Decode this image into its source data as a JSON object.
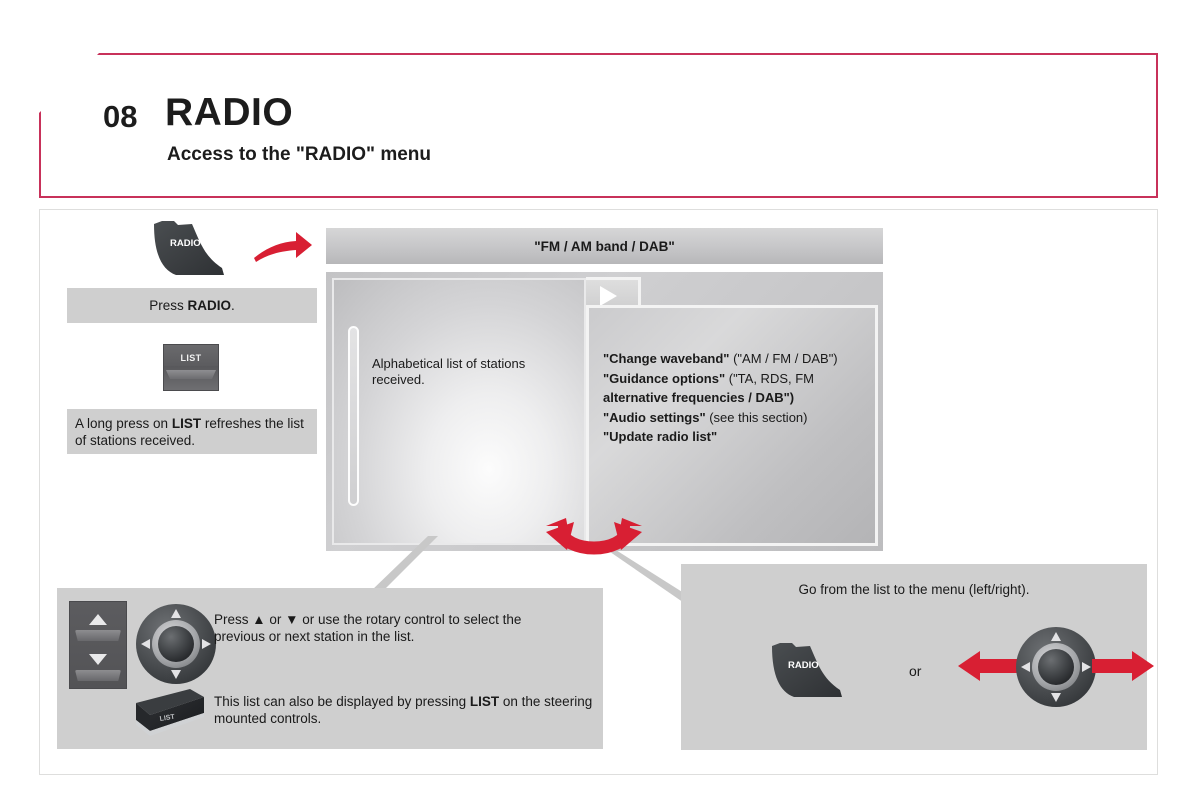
{
  "header": {
    "chapter_number": "08",
    "chapter_title": "RADIO",
    "subtitle": "Access to the \"RADIO\" menu",
    "accent_color": "#c8315a"
  },
  "left_column": {
    "radio_key_label": "RADIO",
    "press_radio_caption": "Press RADIO.",
    "press_radio_caption_plain": "Press ",
    "press_radio_caption_bold": "RADIO",
    "press_radio_caption_tail": ".",
    "list_key_label": "LIST",
    "list_caption_part1": "A long press on ",
    "list_caption_bold": "LIST",
    "list_caption_part2": " refreshes the list of stations received."
  },
  "screen": {
    "title": "\"FM / AM band / DAB\"",
    "list_pane_text": "Alphabetical list of stations received.",
    "menu_items": [
      {
        "quoted": "\"Change waveband\"",
        "rest": " (\"AM / FM / DAB\")"
      },
      {
        "quoted": "\"Guidance options\"",
        "rest": " (\"TA, RDS, FM"
      },
      {
        "quoted": "alternative frequencies / DAB\")",
        "rest": ""
      },
      {
        "quoted": "\"Audio settings\"",
        "rest": " (see this section)"
      },
      {
        "quoted": "\"Update radio list\"",
        "rest": ""
      }
    ],
    "pointer_icon": "play-triangle-icon"
  },
  "bottom_left_panel": {
    "rocker_icon": "up-down-rocker-icon",
    "rotary_icon": "rotary-control-icon",
    "instruction_line1": "Press ▲ or ▼ or use the rotary control to select the",
    "instruction_line2": "previous or next station in the list.",
    "steering_key_label": "LIST",
    "instruction2_part1": "This list can also be displayed by pressing ",
    "instruction2_bold": "LIST",
    "instruction2_part2": " on the steering mounted controls."
  },
  "bottom_right_panel": {
    "title": "Go from the list to the menu (left/right).",
    "radio_key_label": "RADIO",
    "or_label": "or",
    "rotary_icon": "rotary-control-icon",
    "left_arrow_icon": "left-arrow-icon",
    "right_arrow_icon": "right-arrow-icon"
  },
  "colors": {
    "accent_red": "#d81f33",
    "header_border": "#c8315a",
    "panel_gray": "#cfcfcf",
    "key_dark": "#3c3f42"
  }
}
